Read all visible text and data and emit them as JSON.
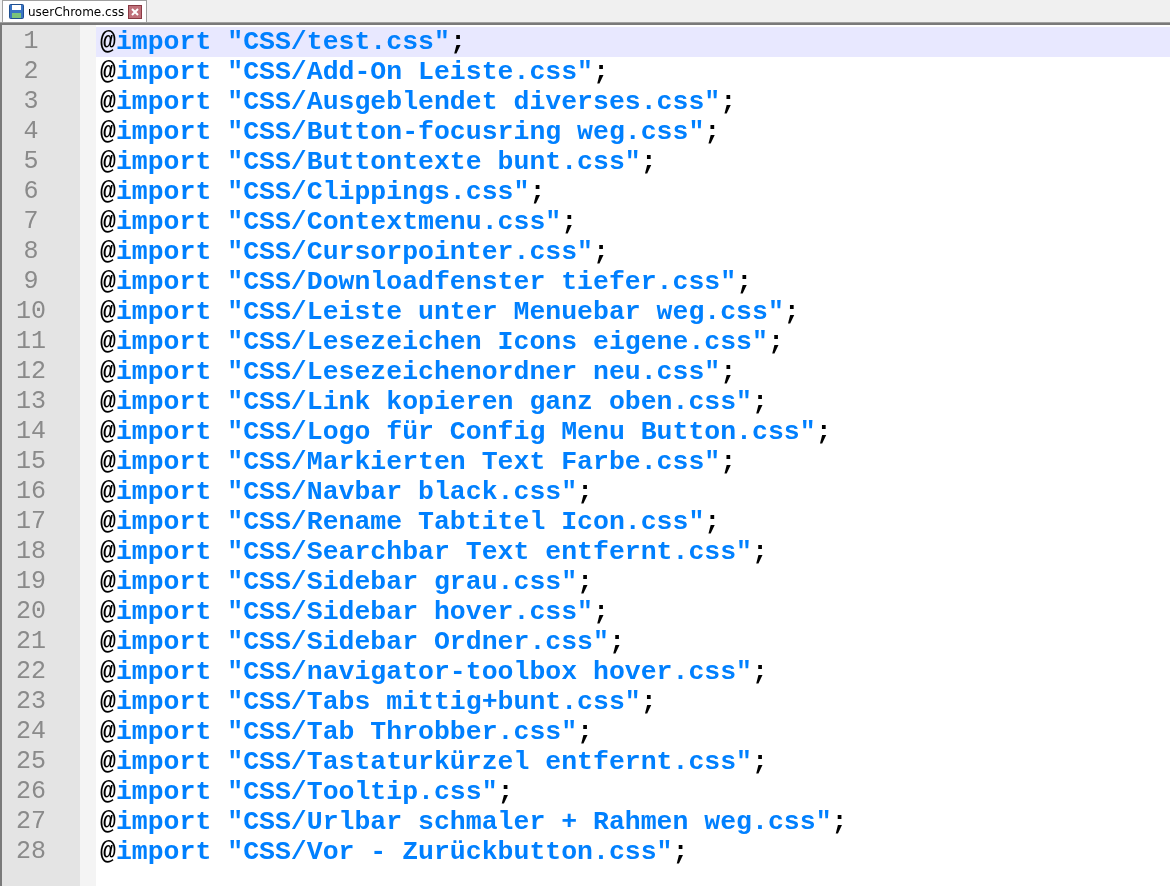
{
  "tab": {
    "title": "userChrome.css"
  },
  "lines": [
    {
      "number": "1",
      "at": "@",
      "keyword": "import",
      "string": "\"CSS/test.css\"",
      "terminator": ";",
      "current": true
    },
    {
      "number": "2",
      "at": "@",
      "keyword": "import",
      "string": "\"CSS/Add-On Leiste.css\"",
      "terminator": ";",
      "current": false
    },
    {
      "number": "3",
      "at": "@",
      "keyword": "import",
      "string": "\"CSS/Ausgeblendet diverses.css\"",
      "terminator": ";",
      "current": false
    },
    {
      "number": "4",
      "at": "@",
      "keyword": "import",
      "string": "\"CSS/Button-focusring weg.css\"",
      "terminator": ";",
      "current": false
    },
    {
      "number": "5",
      "at": "@",
      "keyword": "import",
      "string": "\"CSS/Buttontexte bunt.css\"",
      "terminator": ";",
      "current": false
    },
    {
      "number": "6",
      "at": "@",
      "keyword": "import",
      "string": "\"CSS/Clippings.css\"",
      "terminator": ";",
      "current": false
    },
    {
      "number": "7",
      "at": "@",
      "keyword": "import",
      "string": "\"CSS/Contextmenu.css\"",
      "terminator": ";",
      "current": false
    },
    {
      "number": "8",
      "at": "@",
      "keyword": "import",
      "string": "\"CSS/Cursorpointer.css\"",
      "terminator": ";",
      "current": false
    },
    {
      "number": "9",
      "at": "@",
      "keyword": "import",
      "string": "\"CSS/Downloadfenster tiefer.css\"",
      "terminator": ";",
      "current": false
    },
    {
      "number": "10",
      "at": "@",
      "keyword": "import",
      "string": "\"CSS/Leiste unter Menuebar weg.css\"",
      "terminator": ";",
      "current": false
    },
    {
      "number": "11",
      "at": "@",
      "keyword": "import",
      "string": "\"CSS/Lesezeichen Icons eigene.css\"",
      "terminator": ";",
      "current": false
    },
    {
      "number": "12",
      "at": "@",
      "keyword": "import",
      "string": "\"CSS/Lesezeichenordner neu.css\"",
      "terminator": ";",
      "current": false
    },
    {
      "number": "13",
      "at": "@",
      "keyword": "import",
      "string": "\"CSS/Link kopieren ganz oben.css\"",
      "terminator": ";",
      "current": false
    },
    {
      "number": "14",
      "at": "@",
      "keyword": "import",
      "string": "\"CSS/Logo für Config Menu Button.css\"",
      "terminator": ";",
      "current": false
    },
    {
      "number": "15",
      "at": "@",
      "keyword": "import",
      "string": "\"CSS/Markierten Text Farbe.css\"",
      "terminator": ";",
      "current": false
    },
    {
      "number": "16",
      "at": "@",
      "keyword": "import",
      "string": "\"CSS/Navbar black.css\"",
      "terminator": ";",
      "current": false
    },
    {
      "number": "17",
      "at": "@",
      "keyword": "import",
      "string": "\"CSS/Rename Tabtitel Icon.css\"",
      "terminator": ";",
      "current": false
    },
    {
      "number": "18",
      "at": "@",
      "keyword": "import",
      "string": "\"CSS/Searchbar Text entfernt.css\"",
      "terminator": ";",
      "current": false
    },
    {
      "number": "19",
      "at": "@",
      "keyword": "import",
      "string": "\"CSS/Sidebar grau.css\"",
      "terminator": ";",
      "current": false
    },
    {
      "number": "20",
      "at": "@",
      "keyword": "import",
      "string": "\"CSS/Sidebar hover.css\"",
      "terminator": ";",
      "current": false
    },
    {
      "number": "21",
      "at": "@",
      "keyword": "import",
      "string": "\"CSS/Sidebar Ordner.css\"",
      "terminator": ";",
      "current": false
    },
    {
      "number": "22",
      "at": "@",
      "keyword": "import",
      "string": "\"CSS/navigator-toolbox hover.css\"",
      "terminator": ";",
      "current": false
    },
    {
      "number": "23",
      "at": "@",
      "keyword": "import",
      "string": "\"CSS/Tabs mittig+bunt.css\"",
      "terminator": ";",
      "current": false
    },
    {
      "number": "24",
      "at": "@",
      "keyword": "import",
      "string": "\"CSS/Tab Throbber.css\"",
      "terminator": ";",
      "current": false
    },
    {
      "number": "25",
      "at": "@",
      "keyword": "import",
      "string": "\"CSS/Tastaturkürzel entfernt.css\"",
      "terminator": ";",
      "current": false
    },
    {
      "number": "26",
      "at": "@",
      "keyword": "import",
      "string": "\"CSS/Tooltip.css\"",
      "terminator": ";",
      "current": false
    },
    {
      "number": "27",
      "at": "@",
      "keyword": "import",
      "string": "\"CSS/Urlbar schmaler + Rahmen weg.css\"",
      "terminator": ";",
      "current": false
    },
    {
      "number": "28",
      "at": "@",
      "keyword": "import",
      "string": "\"CSS/Vor - Zurückbutton.css\"",
      "terminator": ";",
      "current": false
    }
  ]
}
